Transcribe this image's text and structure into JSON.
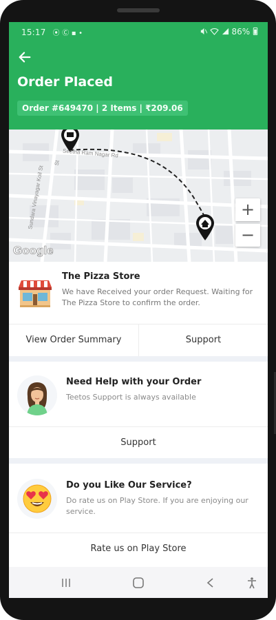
{
  "status_bar": {
    "time": "15:17",
    "left_icons": "⦿ Ⓒ ▪ •",
    "battery": "86%"
  },
  "header": {
    "title": "Order Placed",
    "order_summary": "Order #649470 | 2 Items | ₹209.06",
    "back_icon": "arrow-left-icon"
  },
  "map": {
    "road_labels": [
      "Seetha Ram Nagar Rd",
      "Sundara Vinayagar Koil St",
      "St"
    ],
    "zoom_in": "+",
    "zoom_out": "−",
    "attribution": "Google",
    "markers": [
      "restaurant-pin-icon",
      "home-pin-icon"
    ]
  },
  "store": {
    "name": "The Pizza Store",
    "message": "We have Received your order Request. Waiting for The Pizza Store to confirm the order.",
    "view_summary_label": "View Order Summary",
    "support_label": "Support"
  },
  "help": {
    "title": "Need Help with your Order",
    "subtitle": "Teetos Support is always available",
    "button_label": "Support"
  },
  "service": {
    "title": "Do you Like Our Service?",
    "subtitle": "Do rate us on Play Store. If you are enjoying our service.",
    "button_label": "Rate us on Play Store"
  },
  "navbar": {
    "icons": [
      "recent-apps-icon",
      "home-icon",
      "back-icon",
      "accessibility-icon"
    ]
  },
  "colors": {
    "brand_green": "#29b05c",
    "chip_green": "#3fc174",
    "section_gap": "#eef1f6"
  }
}
